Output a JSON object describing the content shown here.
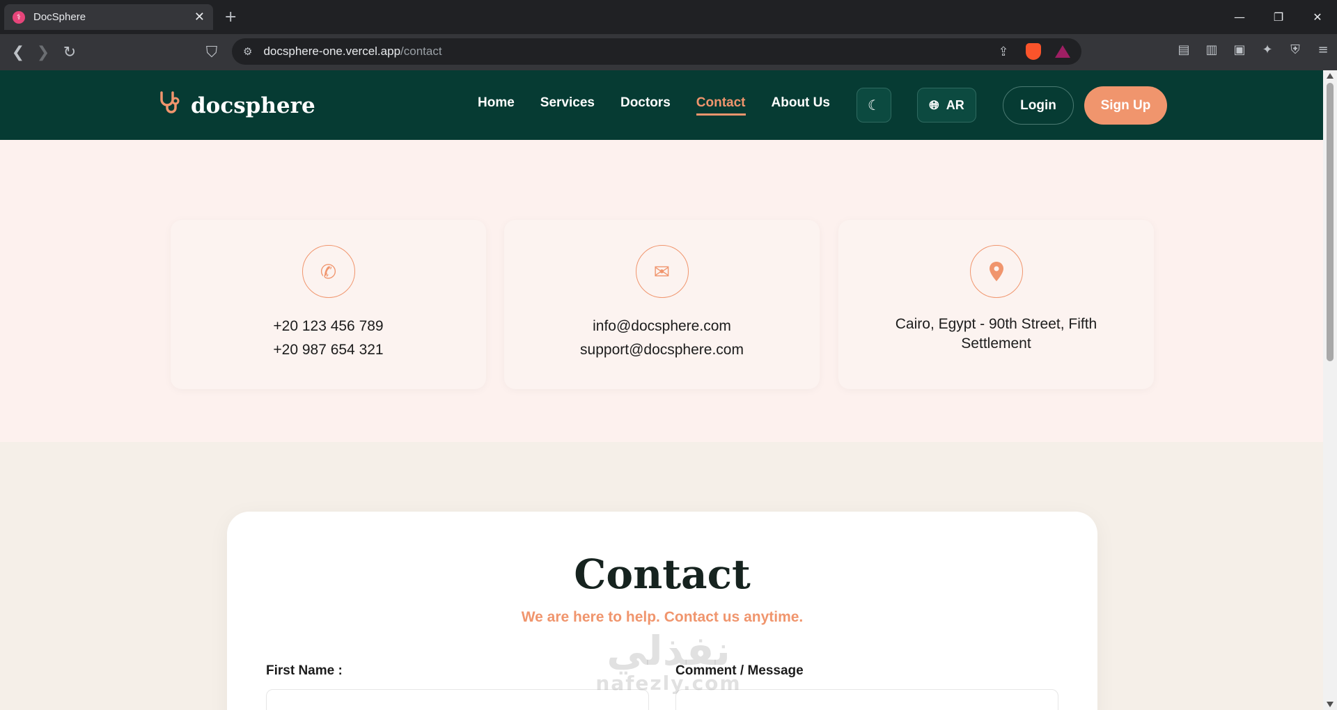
{
  "browser": {
    "tab_title": "DocSphere",
    "url_host": "docsphere-one.vercel.app",
    "url_path": "/contact",
    "icons": [
      "back-icon",
      "forward-icon",
      "reload-icon",
      "bookmark-icon",
      "site-settings-icon",
      "share-icon",
      "brave-shields-icon",
      "brave-rewards-icon",
      "reader-mode-icon",
      "sidebar-icon",
      "wallet-icon",
      "leo-ai-icon",
      "vpn-icon",
      "menu-icon"
    ]
  },
  "header": {
    "logo_text": "docsphere",
    "nav": [
      {
        "label": "Home"
      },
      {
        "label": "Services"
      },
      {
        "label": "Doctors"
      },
      {
        "label": "Contact"
      },
      {
        "label": "About Us"
      }
    ],
    "active_nav": "Contact",
    "lang_label": "AR",
    "login_label": "Login",
    "signup_label": "Sign Up",
    "colors": {
      "header_bg": "#063b33",
      "accent": "#f0956d"
    }
  },
  "info_cards": [
    {
      "icon": "phone-icon",
      "lines": [
        "+20 123 456 789",
        "+20 987 654 321"
      ]
    },
    {
      "icon": "envelope-icon",
      "lines": [
        "info@docsphere.com",
        "support@docsphere.com"
      ]
    },
    {
      "icon": "map-pin-icon",
      "lines": [
        "Cairo, Egypt - 90th Street, Fifth Settlement"
      ]
    }
  ],
  "contact": {
    "title": "Contact",
    "subtitle": "We are here to help. Contact us anytime.",
    "first_name_label": "First Name :",
    "comment_label": "Comment / Message"
  },
  "watermark": {
    "arabic": "نفذلي",
    "latin": "nafezly.com"
  }
}
